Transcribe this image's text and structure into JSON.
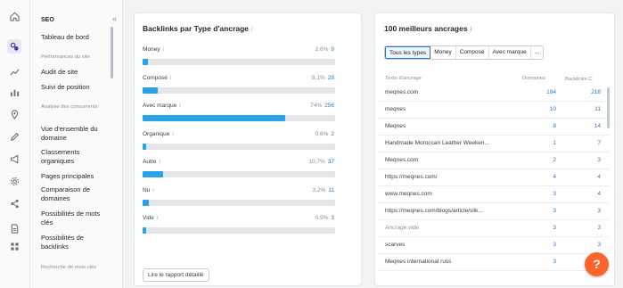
{
  "sidebar": {
    "section_title": "SEO",
    "items": [
      {
        "label": "Tableau de bord",
        "kind": "link"
      },
      {
        "label": "Performances du site",
        "kind": "small"
      },
      {
        "label": "Audit de site",
        "kind": "link"
      },
      {
        "label": "Suivi de position",
        "kind": "link"
      },
      {
        "label": "Analyse des concurrents",
        "kind": "small"
      },
      {
        "label": "Vue d'ensemble du domaine",
        "kind": "link"
      },
      {
        "label": "Classements organiques",
        "kind": "link"
      },
      {
        "label": "Pages principales",
        "kind": "link"
      },
      {
        "label": "Comparaison de domaines",
        "kind": "link"
      },
      {
        "label": "Possibilités de mots clés",
        "kind": "link"
      },
      {
        "label": "Possibilités de backlinks",
        "kind": "link"
      },
      {
        "label": "Recherche de mots clés",
        "kind": "small"
      }
    ],
    "rail_icons": [
      "home-icon",
      "seo-icon",
      "chart-up-icon",
      "bars-icon",
      "pin-icon",
      "pencil-icon",
      "megaphone-icon",
      "gear-icon",
      "share-icon",
      "document-icon",
      "grid-icon"
    ]
  },
  "backlinks_card": {
    "title": "Backlinks par Type d'ancrage",
    "info": "i",
    "rows": [
      {
        "label": "Money",
        "pct": "2,6%",
        "count": "9",
        "fill": 0.026
      },
      {
        "label": "Composé",
        "pct": "8,1%",
        "count": "28",
        "fill": 0.081
      },
      {
        "label": "Avec marque",
        "pct": "74%",
        "count": "256",
        "fill": 0.74
      },
      {
        "label": "Organique",
        "pct": "0,6%",
        "count": "2",
        "fill": 0.006
      },
      {
        "label": "Autre",
        "pct": "10,7%",
        "count": "37",
        "fill": 0.107
      },
      {
        "label": "Nu",
        "pct": "3,2%",
        "count": "11",
        "fill": 0.032
      },
      {
        "label": "Vide",
        "pct": "0,9%",
        "count": "3",
        "fill": 0.009
      }
    ],
    "report_button": "Lire le rapport détaillé"
  },
  "anchors_card": {
    "title": "100 meilleurs ancrages",
    "info": "i",
    "tabs": [
      "Tous les types",
      "Money",
      "Composé",
      "Avec marque",
      "..."
    ],
    "columns": {
      "anchor": "Texte d'ancrage",
      "domains": "Domaines",
      "backlinks": "Backlinks"
    },
    "rows": [
      {
        "anchor": "meqnes.com",
        "domains": "184",
        "backlinks": "218"
      },
      {
        "anchor": "meqnes",
        "domains": "10",
        "backlinks": "11"
      },
      {
        "anchor": "Meqnes",
        "domains": "8",
        "backlinks": "14"
      },
      {
        "anchor": "Handmade Moroccan Leather Weeken...",
        "domains": "1",
        "backlinks": "7"
      },
      {
        "anchor": "Meqnes.com",
        "domains": "2",
        "backlinks": "3"
      },
      {
        "anchor": "https://meqnes.com/",
        "domains": "4",
        "backlinks": "4"
      },
      {
        "anchor": "www.meqnes.com",
        "domains": "3",
        "backlinks": "4"
      },
      {
        "anchor": "https://meqnes.com/blogs/article/slik...",
        "domains": "3",
        "backlinks": "3"
      },
      {
        "anchor": "Ancrage vide",
        "domains": "3",
        "backlinks": "3",
        "muted": true
      },
      {
        "anchor": "scarves",
        "domains": "3",
        "backlinks": "3"
      },
      {
        "anchor": "Meqnes international russ",
        "domains": "3",
        "backlinks": "3"
      }
    ]
  },
  "help_label": "?",
  "colors": {
    "bar": "#2aa2e8",
    "track": "#e4e6ea",
    "link": "#2a78d6",
    "help": "#ff642d"
  }
}
